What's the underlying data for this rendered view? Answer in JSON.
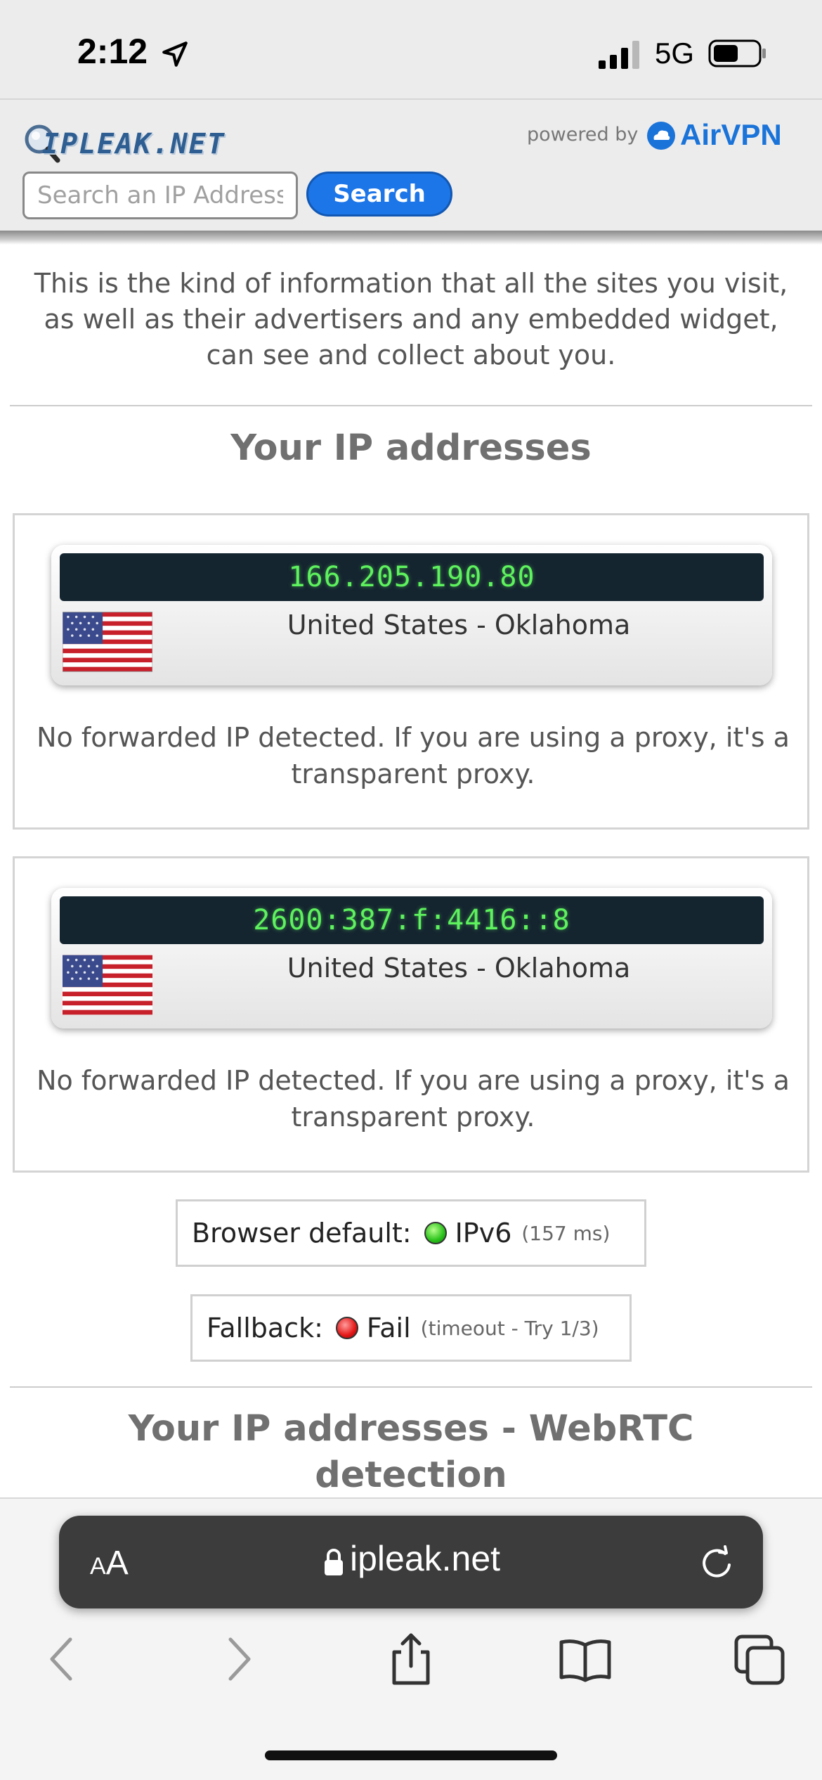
{
  "status_bar": {
    "time": "2:12",
    "network": "5G",
    "icons": [
      "location-arrow-icon",
      "signal-bars-icon",
      "battery-icon"
    ]
  },
  "header": {
    "logo_text": "IPLEAK.NET",
    "powered_by": "powered by",
    "partner": "AirVPN",
    "search_placeholder": "Search an IP Address",
    "search_button": "Search",
    "accent_color": "#1d76e8"
  },
  "intro": "This is the kind of information that all the sites you visit, as well as their advertisers and any embedded widget, can see and collect about you.",
  "ip_section": {
    "title": "Your IP addresses",
    "entries": [
      {
        "ip": "166.205.190.80",
        "location": "United States - Oklahoma",
        "note": "No forwarded IP detected. If you are using a proxy, it's a transparent proxy."
      },
      {
        "ip": "2600:387:f:4416::8",
        "location": "United States - Oklahoma",
        "note": "No forwarded IP detected. If you are using a proxy, it's a transparent proxy."
      }
    ],
    "browser_default": {
      "label": "Browser default:",
      "status_color": "green",
      "value": "IPv6",
      "detail": "(157 ms)"
    },
    "fallback": {
      "label": "Fallback:",
      "status_color": "red",
      "value": "Fail",
      "detail": "(timeout - Try 1/3)"
    }
  },
  "webrtc_section": {
    "title": "Your IP addresses - WebRTC detection"
  },
  "browser": {
    "text_size_button": "AA",
    "url": "ipleak.net",
    "toolbar_icons": [
      "back-icon",
      "forward-icon",
      "share-icon",
      "bookmarks-icon",
      "tabs-icon"
    ]
  }
}
